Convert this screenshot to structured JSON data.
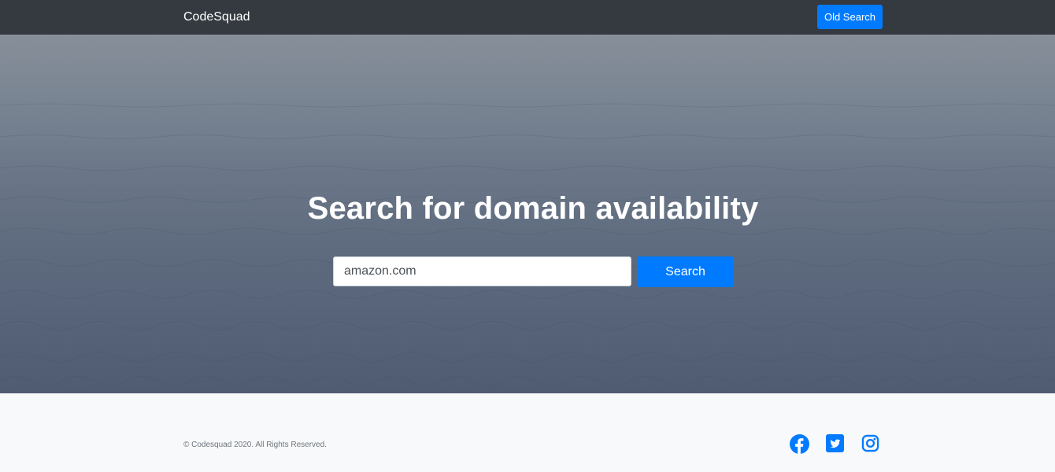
{
  "navbar": {
    "brand": "CodeSquad",
    "old_search_label": "Old Search"
  },
  "hero": {
    "title": "Search for domain availability",
    "search_value": "amazon.com",
    "search_button_label": "Search"
  },
  "footer": {
    "copyright": "© Codesquad 2020. All Rights Reserved.",
    "social_icons": [
      "facebook-icon",
      "twitter-icon",
      "instagram-icon"
    ]
  },
  "colors": {
    "navbar_bg": "#343a40",
    "primary": "#007bff",
    "footer_bg": "#f8f9fa"
  }
}
